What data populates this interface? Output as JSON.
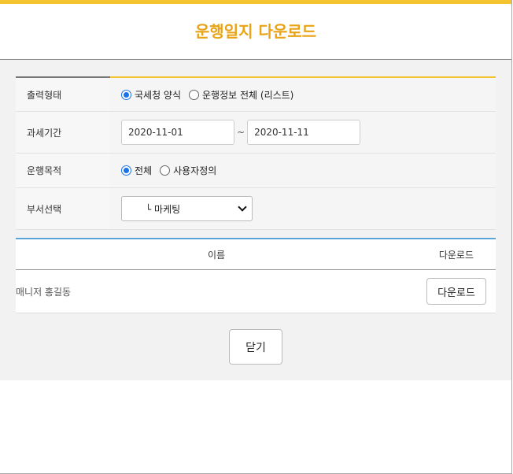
{
  "dialog": {
    "title": "운행일지 다운로드",
    "accent_color": "#f4c430",
    "title_color": "#e8a317"
  },
  "form": {
    "output_type": {
      "label": "출력형태",
      "options": [
        "국세청 양식",
        "운행정보 전체 (리스트)"
      ],
      "selected": "국세청 양식"
    },
    "tax_period": {
      "label": "과세기간",
      "start": "2020-11-01",
      "separator": "~",
      "end": "2020-11-11"
    },
    "purpose": {
      "label": "운행목적",
      "options": [
        "전체",
        "사용자정의"
      ],
      "selected": "전체"
    },
    "department": {
      "label": "부서선택",
      "selected": "└ 마케팅"
    }
  },
  "list": {
    "header_accent": "#5ba4d6",
    "columns": [
      "이름",
      "다운로드"
    ],
    "rows": [
      {
        "name": "매니저 홍길동",
        "button_label": "다운로드"
      }
    ]
  },
  "footer": {
    "close_label": "닫기"
  }
}
